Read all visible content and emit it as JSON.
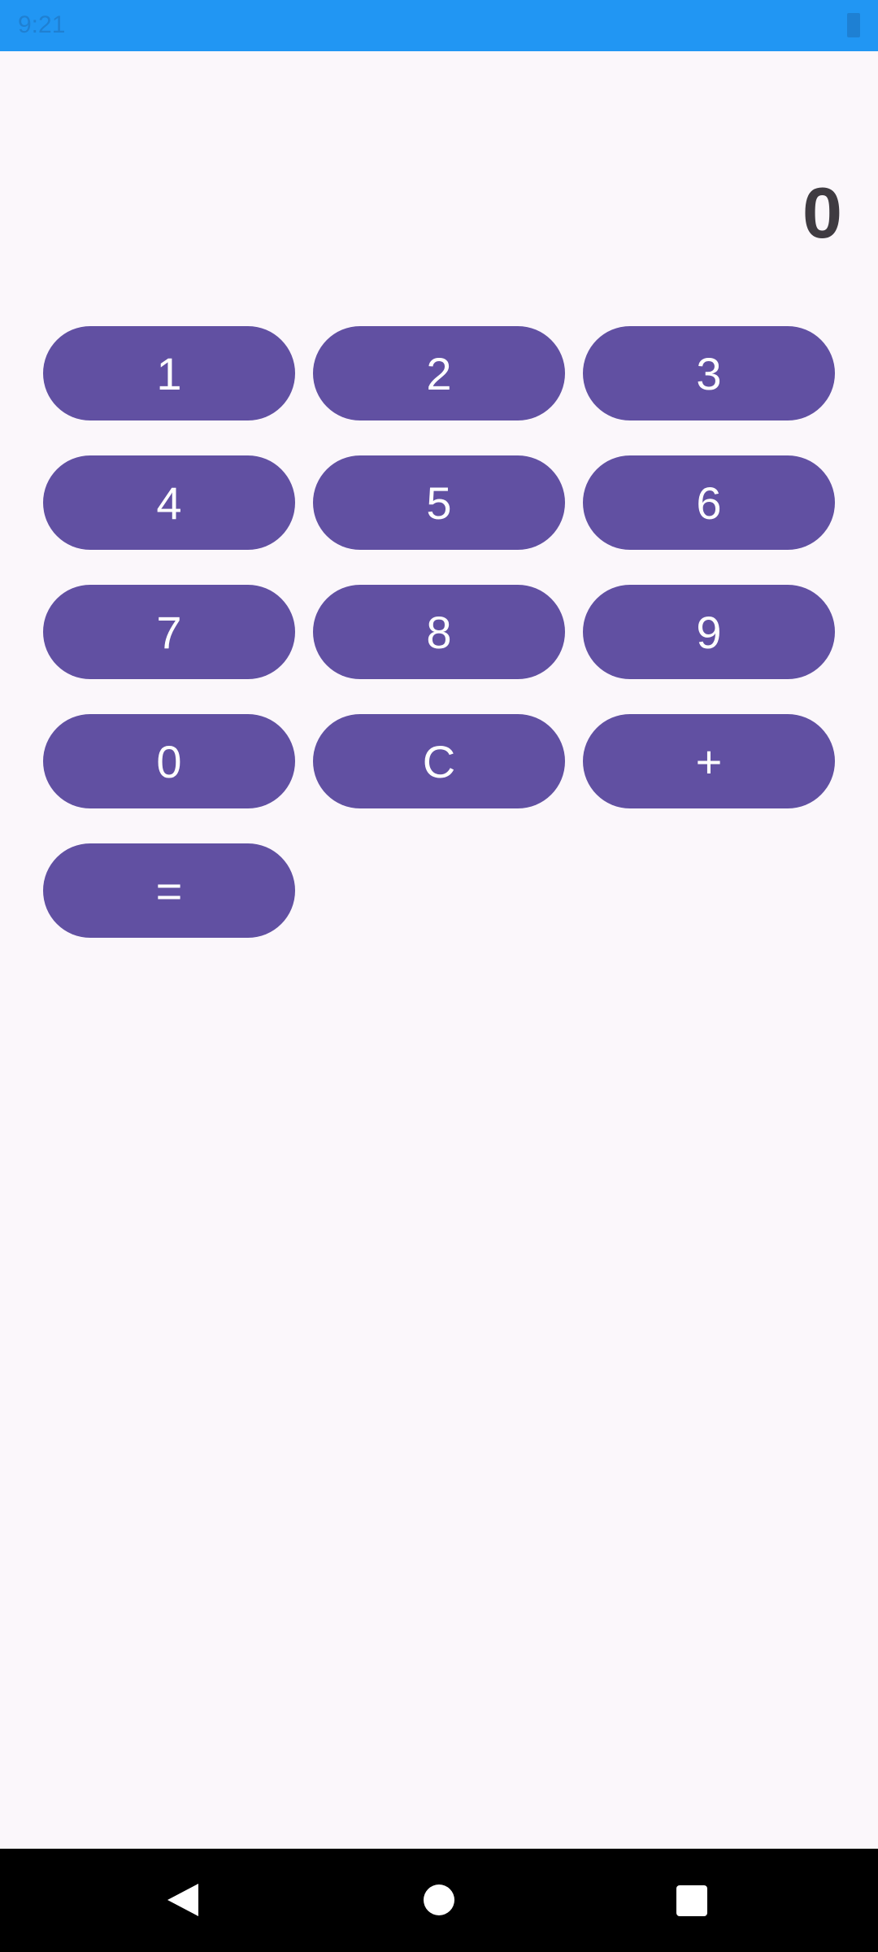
{
  "status_bar": {
    "time": "9:21",
    "color": "#2196f3"
  },
  "display": {
    "value": "0"
  },
  "keypad": {
    "accent_color": "#6150a2",
    "keys": [
      "1",
      "2",
      "3",
      "4",
      "5",
      "6",
      "7",
      "8",
      "9",
      "0",
      "C",
      "+",
      "="
    ]
  },
  "nav_bar": {
    "icons": [
      "back-icon",
      "home-icon",
      "recents-icon"
    ]
  }
}
